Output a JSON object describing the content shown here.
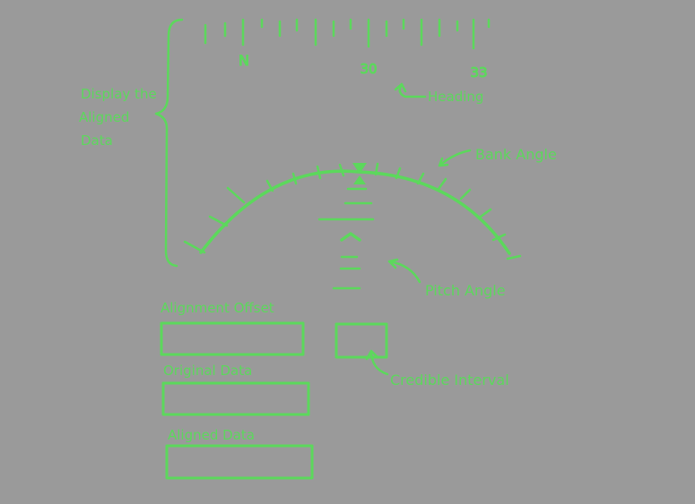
{
  "theme": {
    "ink": "#5cd85c",
    "paper": "#9a9a9a"
  },
  "heading_tape": {
    "labels": [
      "N",
      "30",
      "33"
    ],
    "annotation": "Heading"
  },
  "side_note": [
    "Display the",
    "Aligned",
    "Data"
  ],
  "attitude": {
    "bank_label": "Bank Angle",
    "pitch_label": "Pitch Angle",
    "credible_label": "Credible Interval"
  },
  "fields": [
    {
      "label": "Alignment Offset",
      "value": ""
    },
    {
      "label": "Original Data",
      "value": ""
    },
    {
      "label": "Aligned Data",
      "value": ""
    }
  ]
}
